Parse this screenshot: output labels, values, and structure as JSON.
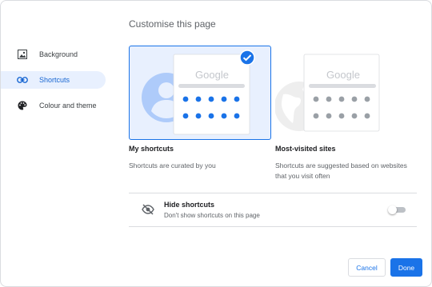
{
  "dialog": {
    "title": "Customise this page"
  },
  "sidebar": {
    "items": [
      {
        "label": "Background",
        "icon": "image-icon",
        "selected": false
      },
      {
        "label": "Shortcuts",
        "icon": "link-icon",
        "selected": true
      },
      {
        "label": "Colour and theme",
        "icon": "palette-icon",
        "selected": false
      }
    ]
  },
  "options": [
    {
      "label": "My shortcuts",
      "description": "Shortcuts are curated by you",
      "selected": true,
      "preview_logo": "Google"
    },
    {
      "label": "Most-visited sites",
      "description": "Shortcuts are suggested based on websites that you visit often",
      "selected": false,
      "preview_logo": "Google"
    }
  ],
  "hide_shortcuts": {
    "title": "Hide shortcuts",
    "description": "Don't show shortcuts on this page",
    "enabled": false
  },
  "buttons": {
    "cancel": "Cancel",
    "done": "Done"
  },
  "colors": {
    "accent": "#1a73e8",
    "selected_bg": "#e8f0fe",
    "tile_grey": "#9aa0a6"
  }
}
